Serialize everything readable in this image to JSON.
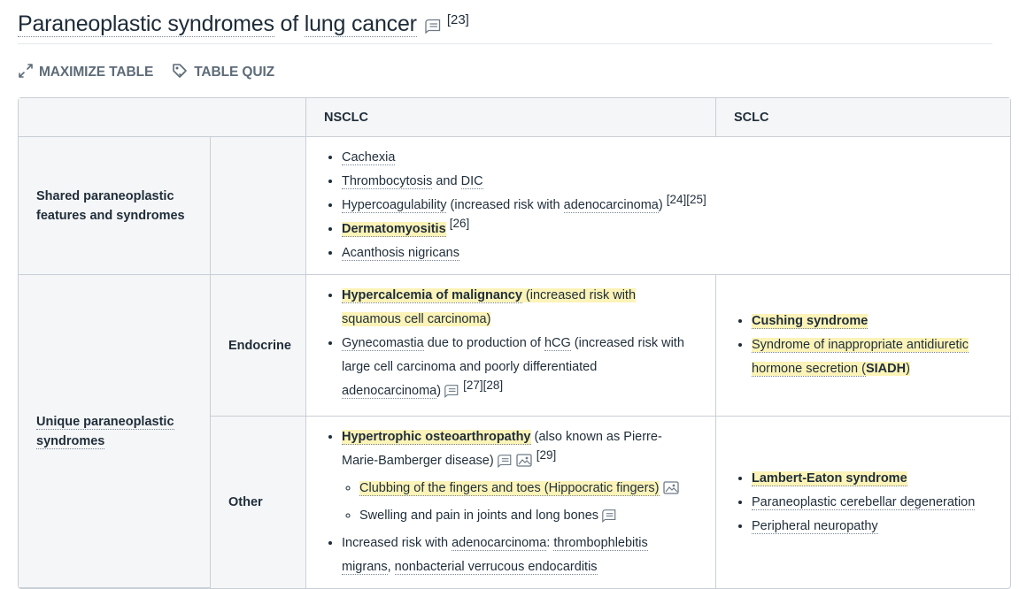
{
  "title": {
    "part1": "Paraneoplastic syndromes",
    "part2": " of ",
    "part3": "lung cancer",
    "ref": "[23]"
  },
  "actions": {
    "maximize": "MAXIMIZE TABLE",
    "quiz": "TABLE QUIZ"
  },
  "table": {
    "headers": {
      "empty": "",
      "nsclc": "NSCLC",
      "sclc": "SCLC"
    },
    "shared": {
      "label": "Shared paraneoplastic features and syndromes",
      "items": {
        "cachexia": "Cachexia",
        "thrombo": "Thrombocytosis",
        "and": " and ",
        "dic": "DIC",
        "hypercoag": "Hypercoagulability",
        "hypercoag_rest1": " (increased risk with ",
        "adeno": "adenocarcinoma",
        "close": ")",
        "hypercoag_ref": "[24][25]",
        "dermato": "Dermatomyositis",
        "dermato_ref": "[26]",
        "acanthosis": "Acanthosis nigricans"
      }
    },
    "unique": {
      "label": "Unique paraneoplastic syndromes",
      "endocrine": {
        "label": "Endocrine",
        "hypercalc": "Hypercalcemia of malignancy",
        "hypercalc_rest": " (increased risk with squamous cell carcinoma)",
        "gyneco": "Gynecomastia",
        "gyneco_mid": " due to production of ",
        "hcg": "hCG",
        "gyneco_rest": " (increased risk with large cell carcinoma and poorly differentiated ",
        "adeno": "adenocarcinoma",
        "close": ")",
        "gyneco_ref": "[27][28]",
        "cushing": "Cushing syndrome",
        "siadh_pre": "Syndrome of inappropriate antidiuretic hormone secretion (",
        "siadh": "SIADH",
        "siadh_post": ")"
      },
      "other": {
        "label": "Other",
        "hoa": "Hypertrophic osteoarthropathy",
        "hoa_rest": " (also known as Pierre-Marie-Bamberger disease)",
        "hoa_ref": "[29]",
        "clubbing": "Clubbing of the fingers and toes (Hippocratic fingers)",
        "swelling": "Swelling and pain in joints and long bones",
        "risk_pre": "Increased risk with ",
        "adeno": "adenocarcinoma",
        "colon": ": ",
        "thrombophlebitis": "thrombophlebitis migrans",
        "comma": ", ",
        "endocarditis": "nonbacterial verrucous endocarditis",
        "lambert": "Lambert-Eaton syndrome",
        "cerebellar": "Paraneoplastic cerebellar degeneration",
        "neuropathy": "Peripheral neuropathy"
      }
    }
  },
  "icons": {
    "note": "note-icon",
    "image": "image-icon",
    "maximize": "expand-arrows-icon",
    "quiz": "quiz-tag-icon"
  },
  "colors": {
    "highlight": "#fbf3b7",
    "header_bg": "#f5f6f7",
    "border": "#c9cfd6",
    "action_text": "#5d6b78"
  }
}
